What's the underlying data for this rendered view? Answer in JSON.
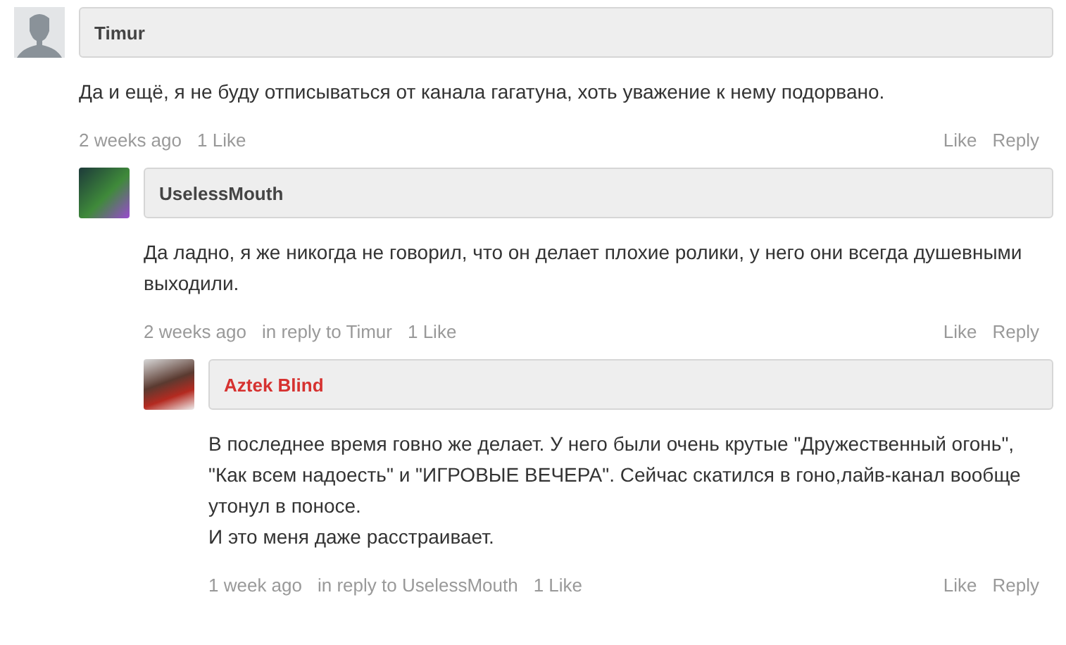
{
  "comments": [
    {
      "author": "Timur",
      "color": "#444444",
      "kind": "silhouette",
      "body": [
        "Да и ещё, я не буду отписываться от канала гагатуна, хоть уважение к нему подорвано."
      ],
      "time": "2 weeks ago",
      "likes": "1 Like",
      "like_action": "Like",
      "reply_action": "Reply",
      "children": [
        {
          "author": "UselessMouth",
          "color": "#444444",
          "kind": "photo",
          "body": [
            "Да ладно, я же никогда не говорил, что он делает плохие ролики, у него они всегда душевными выходили."
          ],
          "time": "2 weeks ago",
          "reply_to": "in reply to Timur",
          "likes": "1 Like",
          "like_action": "Like",
          "reply_action": "Reply",
          "children": [
            {
              "author": "Aztek Blind",
              "color": "#d63230",
              "kind": "photo",
              "body": [
                "В последнее время говно же делает. У него были очень крутые \"Дружественный огонь\", \"Как всем надоесть\" и \"ИГРОВЫЕ ВЕЧЕРА\". Сейчас скатился в гоно,лайв-канал вообще утонул в поносе.",
                "И это меня даже расстраивает."
              ],
              "time": "1 week ago",
              "reply_to": "in reply to UselessMouth",
              "likes": "1 Like",
              "like_action": "Like",
              "reply_action": "Reply"
            }
          ]
        }
      ]
    }
  ]
}
